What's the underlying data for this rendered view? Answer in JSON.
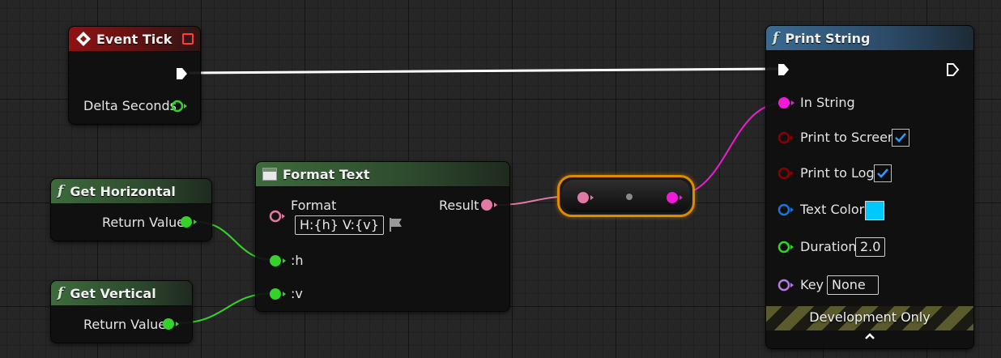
{
  "colors": {
    "exec": "#ffffff",
    "float": "#35d32a",
    "string": "#f01ad8",
    "text": "#e37aa5",
    "bool": "#8a0000",
    "struct": "#1c75d6",
    "name": "#b57ae0",
    "color_swatch": "#00c8ff",
    "reroute_outline": "#e08a00"
  },
  "event_tick": {
    "title": "Event Tick",
    "delta_seconds_label": "Delta Seconds"
  },
  "get_horizontal": {
    "title": "Get Horizontal",
    "return_label": "Return Value"
  },
  "get_vertical": {
    "title": "Get Vertical",
    "return_label": "Return Value"
  },
  "format_text": {
    "title": "Format Text",
    "format_label": "Format",
    "format_value": "H:{h} V:{v}",
    "result_label": "Result",
    "h_label": ":h",
    "v_label": ":v"
  },
  "print_string": {
    "title": "Print String",
    "in_string_label": "In String",
    "print_to_screen_label": "Print to Screen",
    "print_to_screen_checked": true,
    "print_to_log_label": "Print to Log",
    "print_to_log_checked": true,
    "text_color_label": "Text Color",
    "duration_label": "Duration",
    "duration_value": "2.0",
    "key_label": "Key",
    "key_value": "None",
    "footer_label": "Development Only"
  }
}
